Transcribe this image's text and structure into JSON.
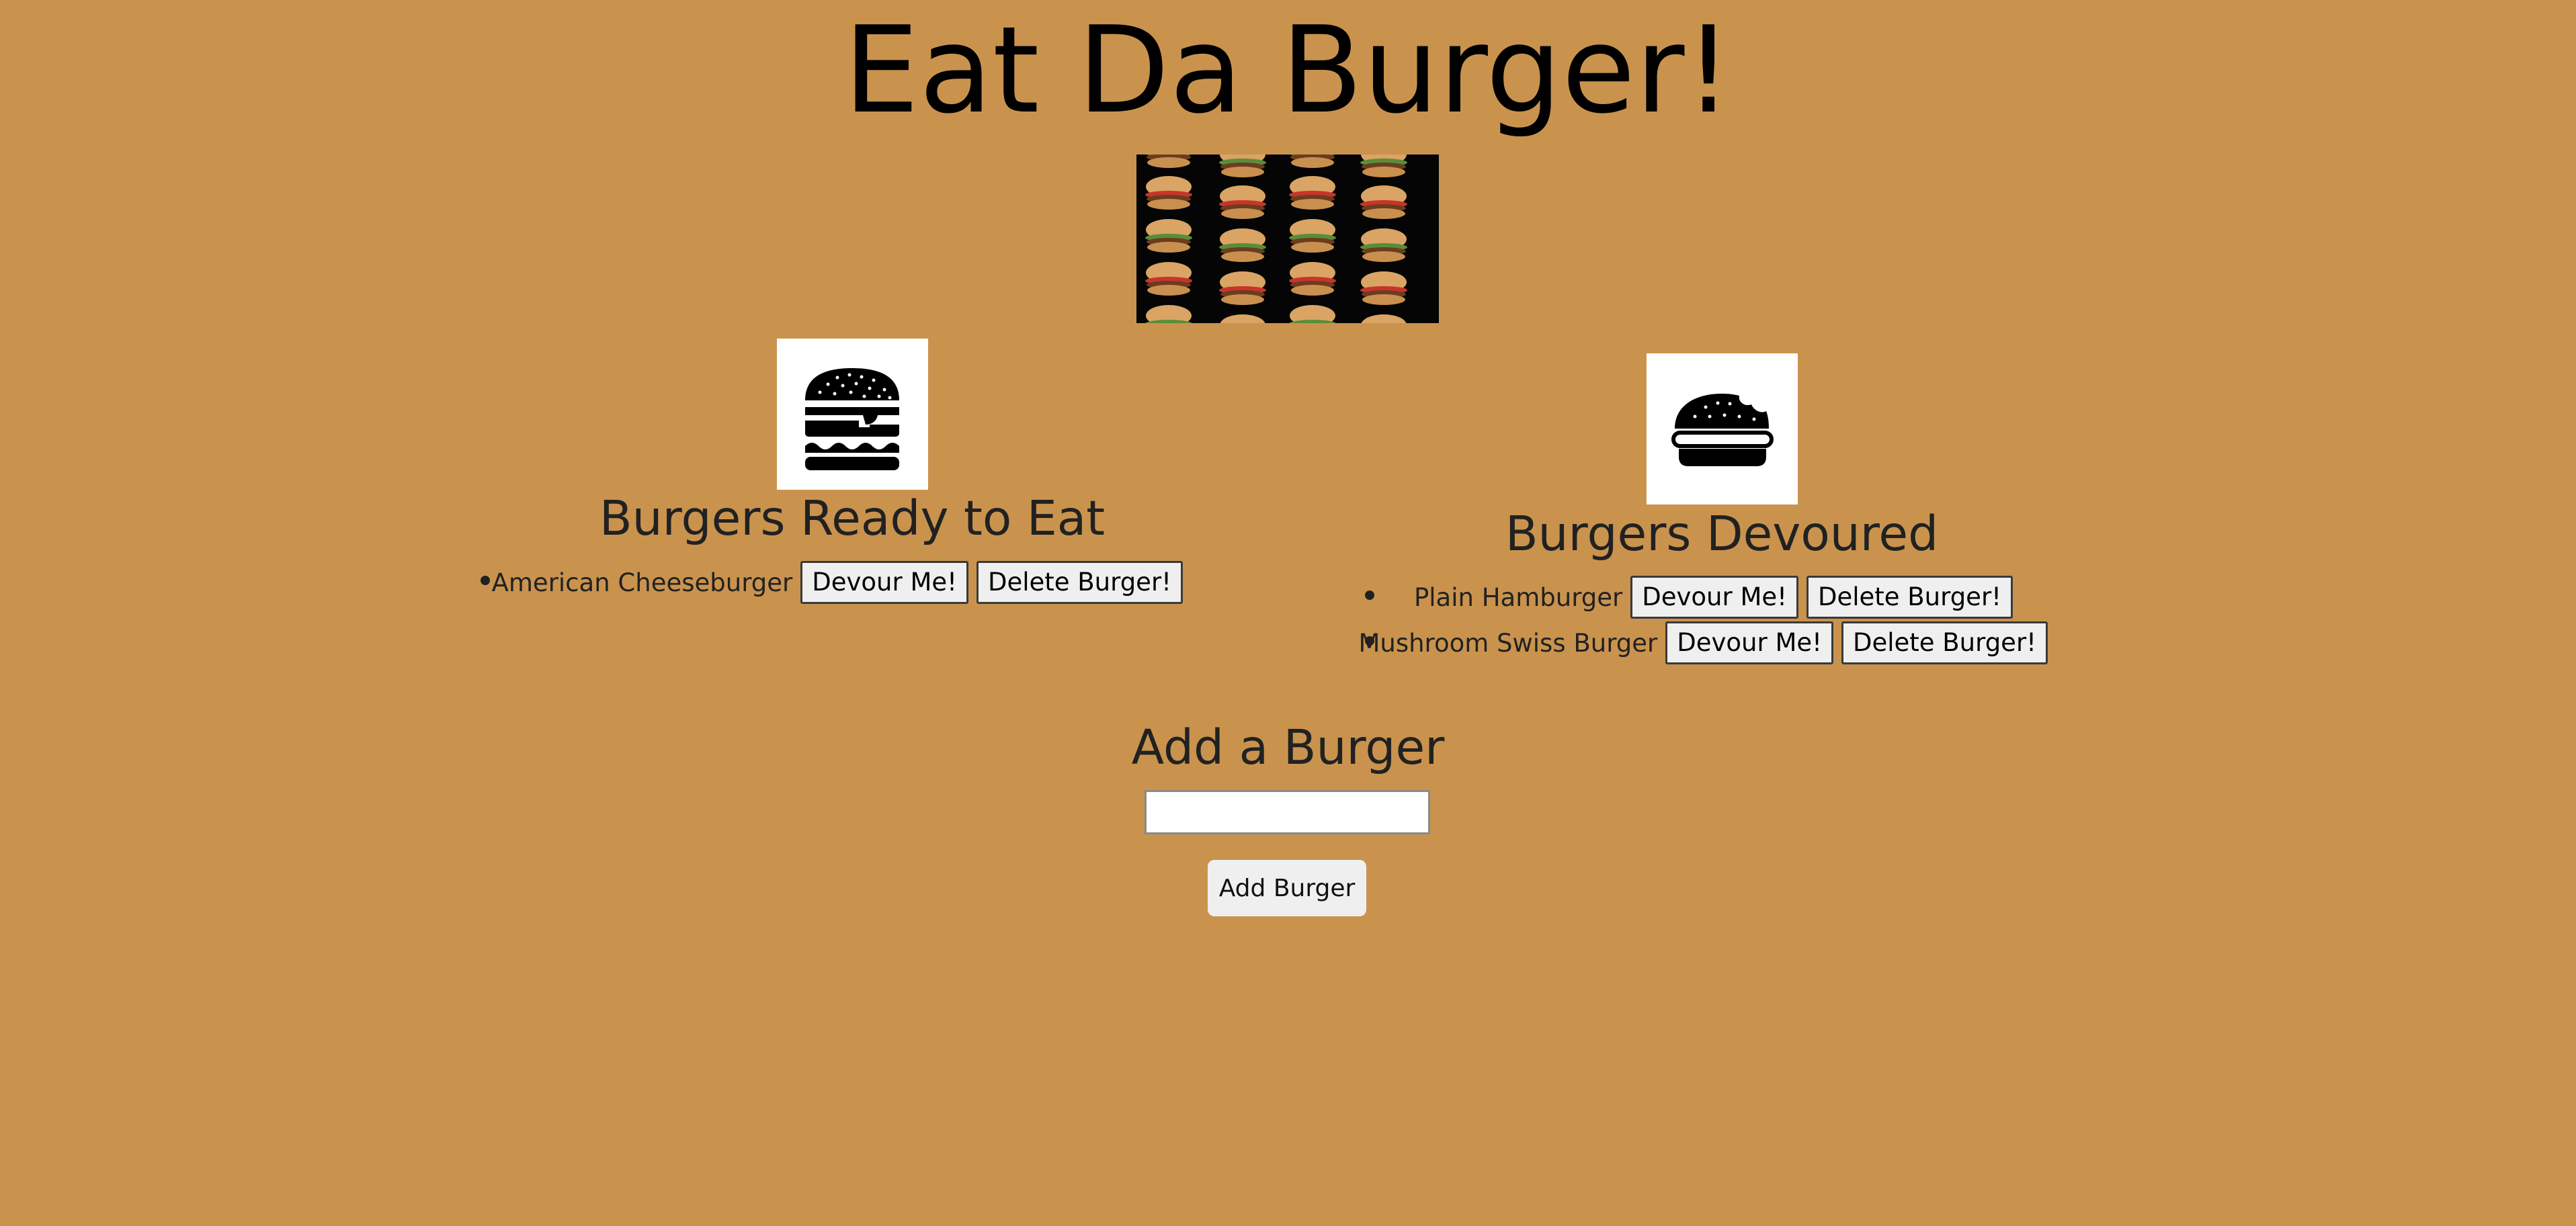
{
  "colors": {
    "background": "#c9934e",
    "text": "#212121",
    "button_bg": "#efefef"
  },
  "header": {
    "title": "Eat Da Burger!"
  },
  "banner": {
    "icon": "burger-pattern-image"
  },
  "ready_section": {
    "icon": "hamburger-icon",
    "heading": "Burgers Ready to Eat",
    "items": [
      {
        "name": "American Cheeseburger",
        "devour_label": "Devour Me!",
        "delete_label": "Delete Burger!"
      }
    ]
  },
  "devoured_section": {
    "icon": "bitten-burger-icon",
    "heading": "Burgers Devoured",
    "items": [
      {
        "name": "Plain Hamburger",
        "devour_label": "Devour Me!",
        "delete_label": "Delete Burger!"
      },
      {
        "name": "Mushroom Swiss Burger",
        "devour_label": "Devour Me!",
        "delete_label": "Delete Burger!"
      }
    ]
  },
  "add_form": {
    "heading": "Add a Burger",
    "input_value": "",
    "submit_label": "Add Burger"
  }
}
